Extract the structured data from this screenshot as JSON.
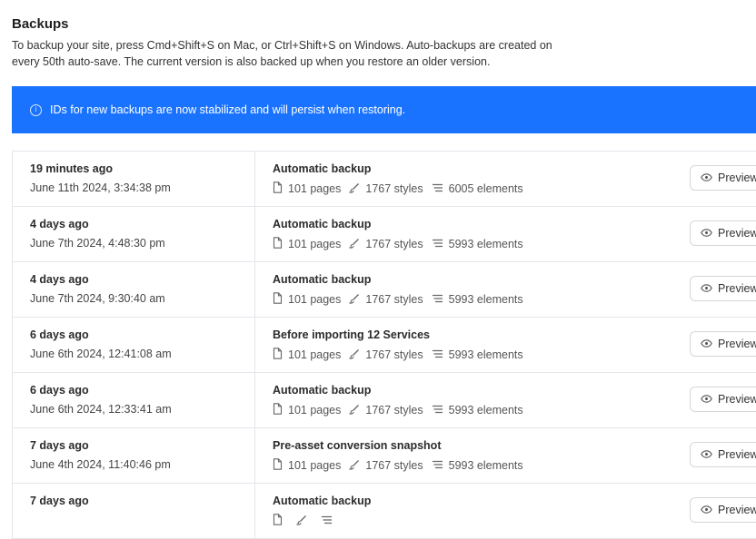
{
  "header": {
    "title": "Backups",
    "description_line1": "To backup your site, press Cmd+Shift+S on Mac, or Ctrl+Shift+S on Windows. Auto-backups are created on",
    "description_line2": "every 50th auto-save. The current version is also backed up when you restore an older version."
  },
  "banner": {
    "icon": "info-icon",
    "text": "IDs for new backups are now stabilized and will persist when restoring."
  },
  "colors": {
    "banner_bg": "#1a73ff",
    "border": "#e4e6ea"
  },
  "preview_label": "Preview",
  "backups": [
    {
      "relative": "19 minutes ago",
      "timestamp": "June 11th 2024, 3:34:38 pm",
      "name": "Automatic backup",
      "pages": "101 pages",
      "styles": "1767 styles",
      "elements": "6005 elements"
    },
    {
      "relative": "4 days ago",
      "timestamp": "June 7th 2024, 4:48:30 pm",
      "name": "Automatic backup",
      "pages": "101 pages",
      "styles": "1767 styles",
      "elements": "5993 elements"
    },
    {
      "relative": "4 days ago",
      "timestamp": "June 7th 2024, 9:30:40 am",
      "name": "Automatic backup",
      "pages": "101 pages",
      "styles": "1767 styles",
      "elements": "5993 elements"
    },
    {
      "relative": "6 days ago",
      "timestamp": "June 6th 2024, 12:41:08 am",
      "name": "Before importing 12 Services",
      "pages": "101 pages",
      "styles": "1767 styles",
      "elements": "5993 elements"
    },
    {
      "relative": "6 days ago",
      "timestamp": "June 6th 2024, 12:33:41 am",
      "name": "Automatic backup",
      "pages": "101 pages",
      "styles": "1767 styles",
      "elements": "5993 elements"
    },
    {
      "relative": "7 days ago",
      "timestamp": "June 4th 2024, 11:40:46 pm",
      "name": "Pre-asset conversion snapshot",
      "pages": "101 pages",
      "styles": "1767 styles",
      "elements": "5993 elements"
    },
    {
      "relative": "7 days ago",
      "timestamp": "",
      "name": "Automatic backup",
      "pages": "",
      "styles": "",
      "elements": ""
    }
  ]
}
